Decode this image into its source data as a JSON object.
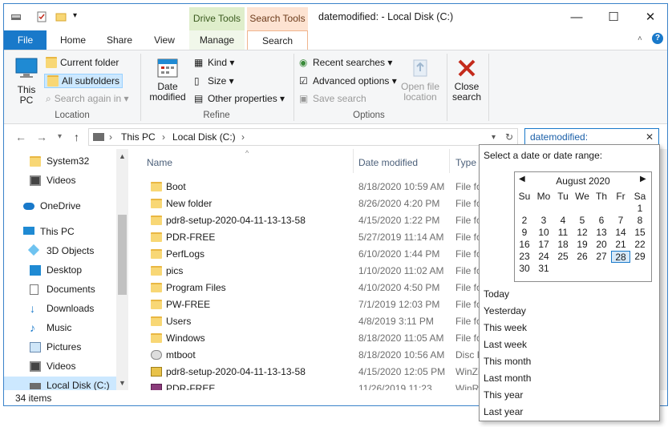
{
  "window": {
    "title": "datemodified: - Local Disk (C:)",
    "tool_tabs": {
      "drive_tools": "Drive Tools",
      "search_tools": "Search Tools"
    },
    "controls": {
      "minimize": "—",
      "maximize": "☐",
      "close": "✕"
    }
  },
  "ribbon_tabs": [
    "File",
    "Home",
    "Share",
    "View",
    "Manage",
    "Search"
  ],
  "ribbon": {
    "location": {
      "this_pc": "This\nPC",
      "current_folder": "Current folder",
      "all_subfolders": "All subfolders",
      "search_again_in": "Search again in",
      "label": "Location"
    },
    "refine": {
      "date_modified": "Date\nmodified",
      "kind": "Kind",
      "size": "Size",
      "other_properties": "Other properties",
      "label": "Refine"
    },
    "options": {
      "recent_searches": "Recent searches",
      "advanced_options": "Advanced options",
      "save_search": "Save search",
      "open_file_location": "Open file\nlocation",
      "close_search": "Close\nsearch",
      "label": "Options"
    }
  },
  "address": {
    "crumbs": [
      "This PC",
      "Local Disk (C:)"
    ],
    "search_value": "datemodified:"
  },
  "nav": [
    {
      "label": "System32",
      "icon": "folder-icon"
    },
    {
      "label": "Videos",
      "icon": "video-folder-icon"
    },
    {
      "label": "OneDrive",
      "icon": "cloud-icon"
    },
    {
      "label": "This PC",
      "icon": "computer-icon"
    },
    {
      "label": "3D Objects",
      "icon": "3d-objects-icon"
    },
    {
      "label": "Desktop",
      "icon": "desktop-icon"
    },
    {
      "label": "Documents",
      "icon": "documents-icon"
    },
    {
      "label": "Downloads",
      "icon": "downloads-icon"
    },
    {
      "label": "Music",
      "icon": "music-icon"
    },
    {
      "label": "Pictures",
      "icon": "pictures-icon"
    },
    {
      "label": "Videos",
      "icon": "video-folder-icon"
    },
    {
      "label": "Local Disk (C:)",
      "icon": "drive-icon"
    }
  ],
  "columns": {
    "name": "Name",
    "date": "Date modified",
    "type": "Type"
  },
  "files": [
    {
      "name": "Boot",
      "date": "8/18/2020 10:59 AM",
      "type": "File fol"
    },
    {
      "name": "New folder",
      "date": "8/26/2020 4:20 PM",
      "type": "File fol"
    },
    {
      "name": "pdr8-setup-2020-04-11-13-13-58",
      "date": "4/15/2020 1:22 PM",
      "type": "File fol"
    },
    {
      "name": "PDR-FREE",
      "date": "5/27/2019 11:14 AM",
      "type": "File fol"
    },
    {
      "name": "PerfLogs",
      "date": "6/10/2020 1:44 PM",
      "type": "File fol"
    },
    {
      "name": "pics",
      "date": "1/10/2020 11:02 AM",
      "type": "File fol"
    },
    {
      "name": "Program Files",
      "date": "4/10/2020 4:50 PM",
      "type": "File fol"
    },
    {
      "name": "PW-FREE",
      "date": "7/1/2019 12:03 PM",
      "type": "File fol"
    },
    {
      "name": "Users",
      "date": "4/8/2019 3:11 PM",
      "type": "File fol"
    },
    {
      "name": "Windows",
      "date": "8/18/2020 11:05 AM",
      "type": "File fol"
    },
    {
      "name": "mtboot",
      "date": "8/18/2020 10:56 AM",
      "type": "Disc In"
    },
    {
      "name": "pdr8-setup-2020-04-11-13-13-58",
      "date": "4/15/2020 12:05 PM",
      "type": "WinZip"
    },
    {
      "name": "PDR-FREE",
      "date": "11/26/2019 11:23 ...",
      "type": "WinRA"
    }
  ],
  "status": {
    "count": "34 items"
  },
  "date_picker": {
    "prompt": "Select a date or date range:",
    "month": "August 2020",
    "weekdays": [
      "Su",
      "Mo",
      "Tu",
      "We",
      "Th",
      "Fr",
      "Sa"
    ],
    "days": [
      "1",
      "2",
      "3",
      "4",
      "5",
      "6",
      "7",
      "8",
      "9",
      "10",
      "11",
      "12",
      "13",
      "14",
      "15",
      "16",
      "17",
      "18",
      "19",
      "20",
      "21",
      "22",
      "23",
      "24",
      "25",
      "26",
      "27",
      "28",
      "29",
      "30",
      "31"
    ],
    "selected_day": "28",
    "presets": [
      "Today",
      "Yesterday",
      "This week",
      "Last week",
      "This month",
      "Last month",
      "This year",
      "Last year"
    ]
  }
}
